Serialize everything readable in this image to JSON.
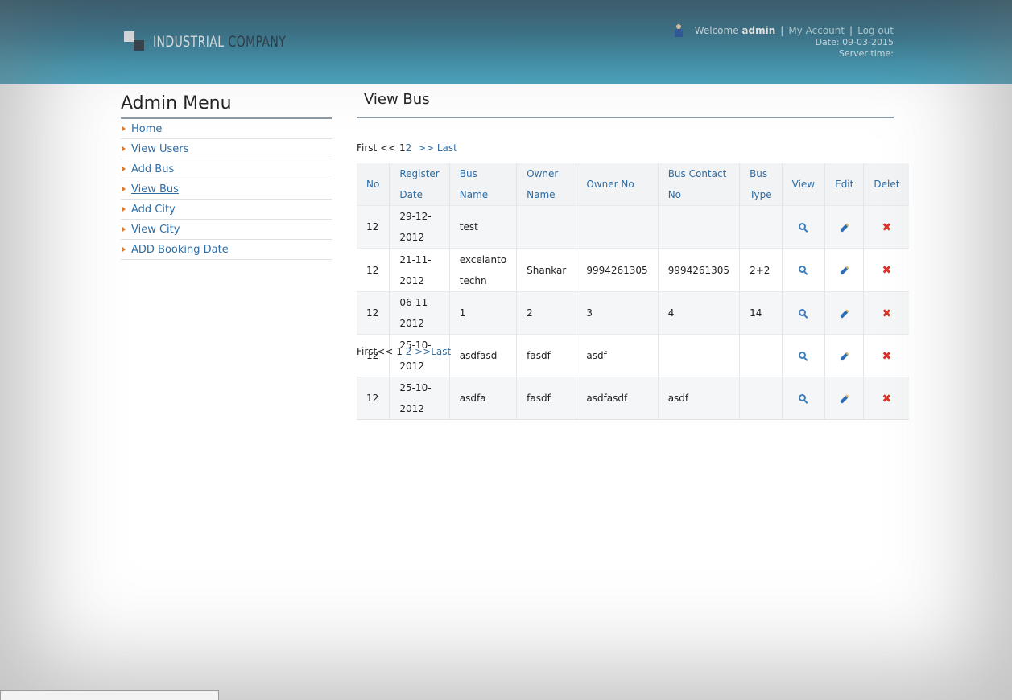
{
  "header": {
    "logo": {
      "word1": "INDUSTRIAL",
      "word2": "COMPANY"
    },
    "welcome_text": "Welcome",
    "username": "admin",
    "my_account": "My Account",
    "logout": "Log out",
    "date_line": "Date: 09-03-2015",
    "server_time": "Server time:"
  },
  "sidebar": {
    "title": "Admin Menu",
    "items": [
      {
        "label": "Home"
      },
      {
        "label": "View Users"
      },
      {
        "label": "Add Bus"
      },
      {
        "label": "View Bus",
        "active": true
      },
      {
        "label": "Add City"
      },
      {
        "label": "View City"
      },
      {
        "label": "ADD Booking Date"
      }
    ]
  },
  "main": {
    "title": "View Bus",
    "pager_top": {
      "first": "First <<",
      "current": "1",
      "page2": "2",
      "last": ">> Last"
    },
    "pager_bottom": {
      "first": "First<<",
      "current": "1",
      "page2": "2",
      "last": ">>Last"
    },
    "table": {
      "headers": {
        "no": "No",
        "register_date_1": "Register",
        "register_date_2": "Date",
        "bus_name_1": "Bus",
        "bus_name_2": "Name",
        "owner_name_1": "Owner",
        "owner_name_2": "Name",
        "owner_no": "Owner No",
        "bus_contact_1": "Bus Contact",
        "bus_contact_2": "No",
        "bus_type_1": "Bus",
        "bus_type_2": "Type",
        "view": "View",
        "edit": "Edit",
        "delete": "Delet"
      },
      "rows": [
        {
          "no": "12",
          "date": "29-12-2012",
          "bus_name_1": "test",
          "bus_name_2": "",
          "owner_name": "",
          "owner_no": "",
          "contact": "",
          "type": ""
        },
        {
          "no": "12",
          "date": "21-11-2012",
          "bus_name_1": "excelanto",
          "bus_name_2": "techn",
          "owner_name": "Shankar",
          "owner_no": "9994261305",
          "contact": "9994261305",
          "type": "2+2"
        },
        {
          "no": "12",
          "date": "06-11-2012",
          "bus_name_1": "1",
          "bus_name_2": "",
          "owner_name": "2",
          "owner_no": "3",
          "contact": "4",
          "type": "14"
        },
        {
          "no": "12",
          "date": "25-10-2012",
          "bus_name_1": "asdfasd",
          "bus_name_2": "",
          "owner_name": "fasdf",
          "owner_no": "asdf",
          "contact": "",
          "type": ""
        },
        {
          "no": "12",
          "date": "25-10-2012",
          "bus_name_1": "asdfa",
          "bus_name_2": "",
          "owner_name": "fasdf",
          "owner_no": "asdfasdf",
          "contact": "asdf",
          "type": ""
        }
      ]
    }
  },
  "colors": {
    "header_dark": "#1f4f66",
    "header_light": "#4aa3bd",
    "link": "#2e6da4",
    "arrow": "#e07a2e",
    "delete": "#d9352b"
  },
  "icons": {
    "view": "zoom-icon",
    "edit": "pencil-icon",
    "delete": "delete-icon",
    "user": "user-icon"
  }
}
